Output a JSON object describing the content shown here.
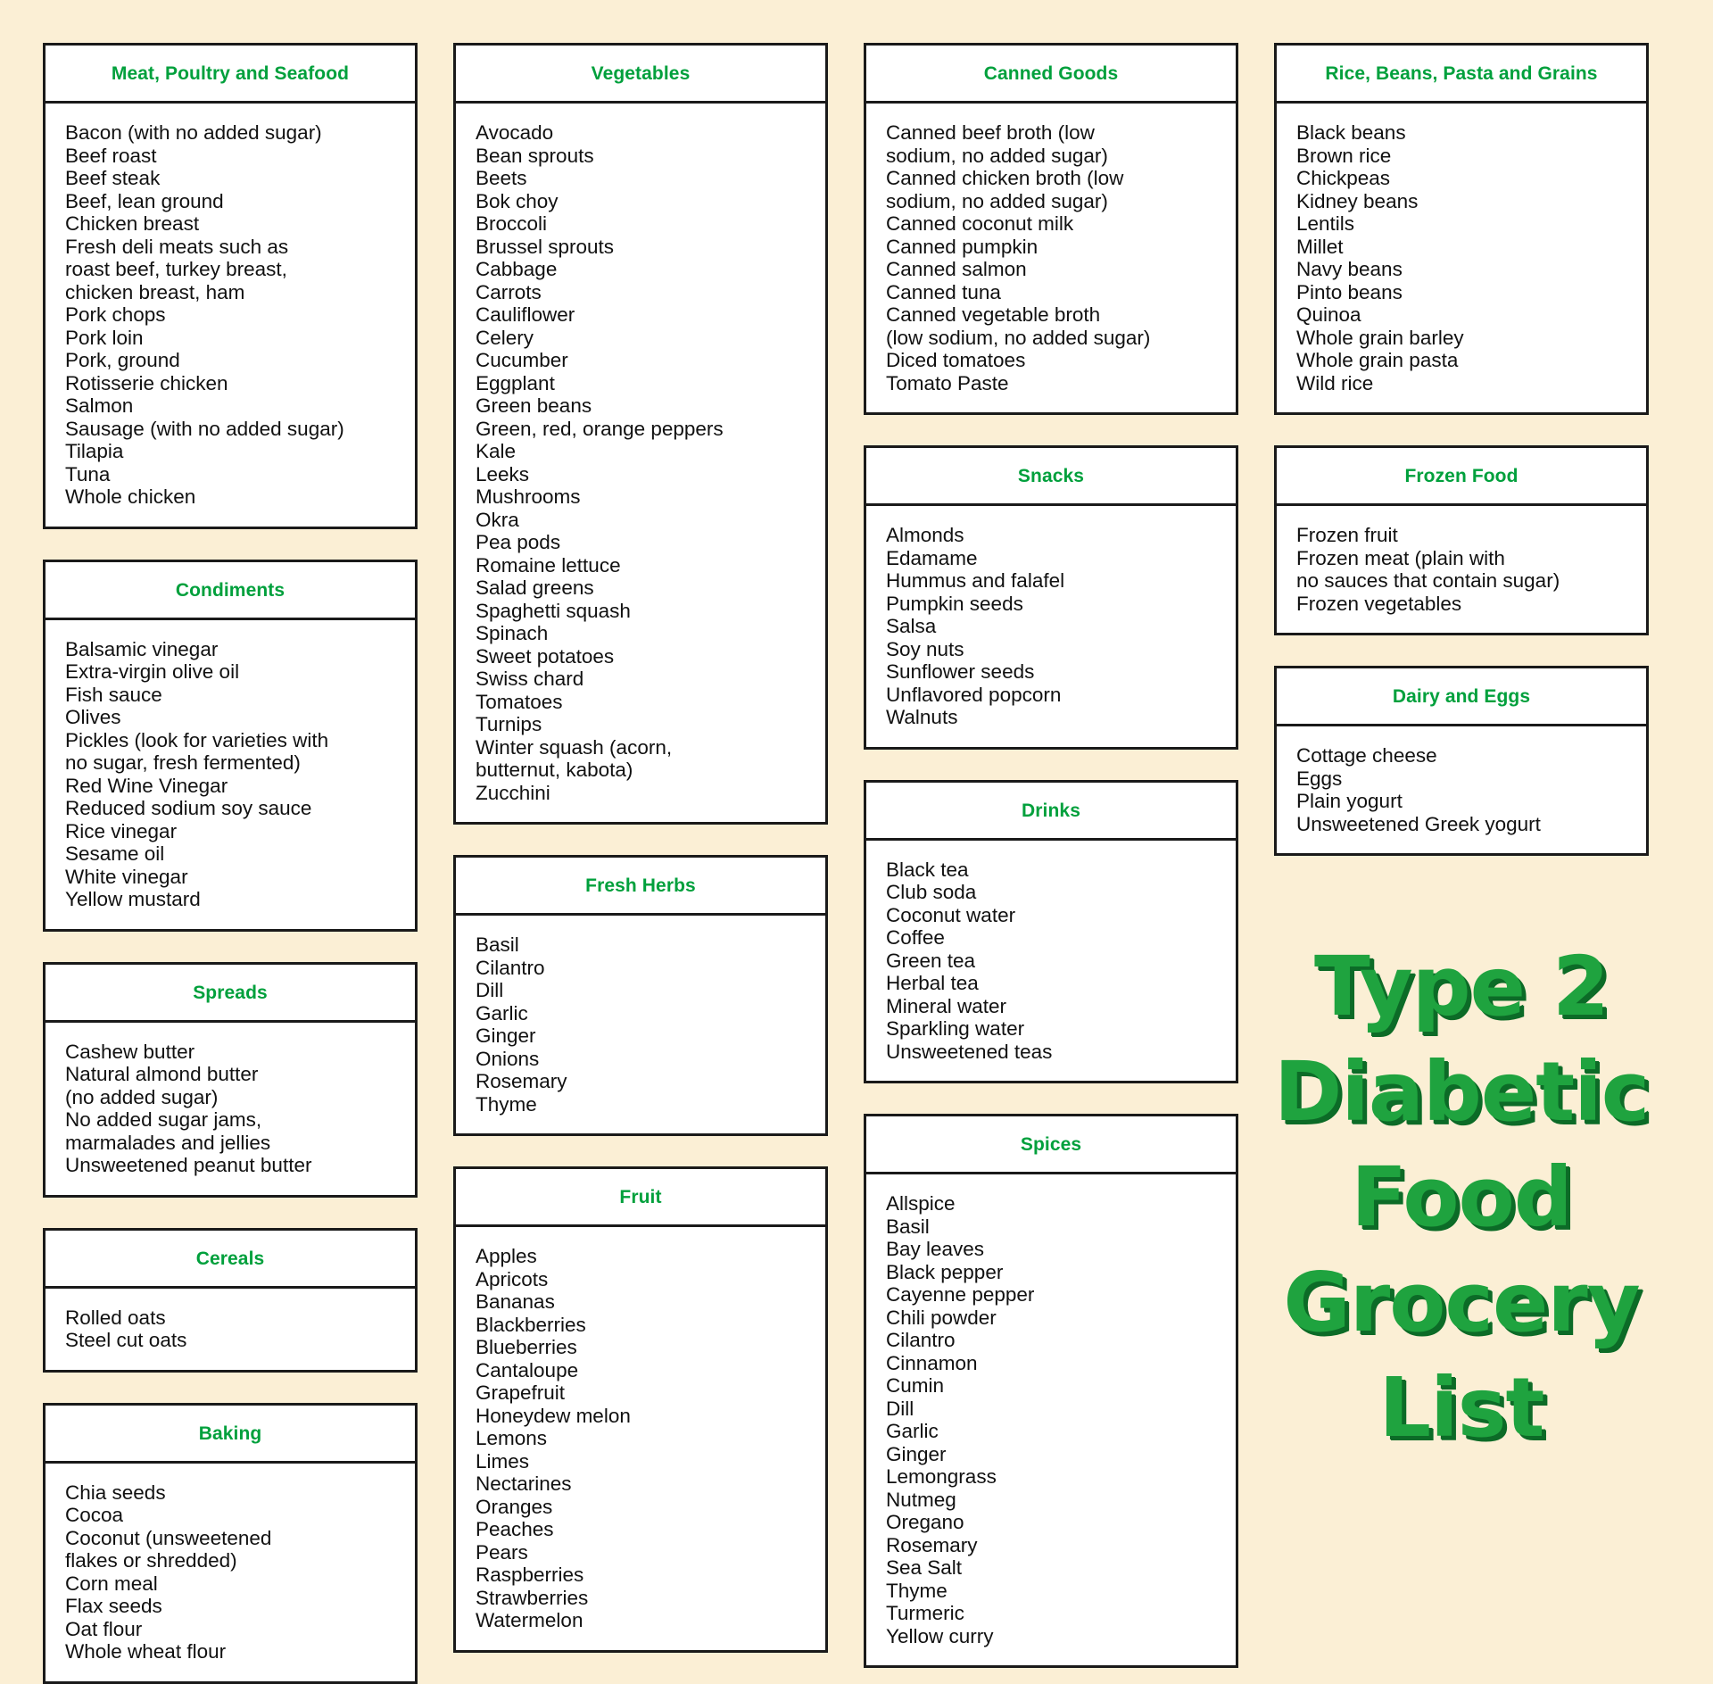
{
  "theme": {
    "background": "#fbefd5",
    "header_green": "#00a03c",
    "title_green": "#1fa33f",
    "title_shadow_green": "#0c6b27",
    "border": "#1a1a1a",
    "card_background": "#ffffff",
    "text": "#111111"
  },
  "title": {
    "lines": [
      "Type 2",
      "Diabetic",
      "Food",
      "Grocery",
      "List"
    ]
  },
  "columns": [
    {
      "name": "column-1",
      "sections": [
        {
          "heading": "Meat, Poultry and Seafood",
          "items": [
            "Bacon (with no added sugar)",
            "Beef roast",
            "Beef steak",
            "Beef, lean ground",
            "Chicken breast",
            "Fresh deli meats such as\nroast beef, turkey breast,\nchicken breast, ham",
            "Pork chops",
            "Pork loin",
            "Pork, ground",
            "Rotisserie chicken",
            "Salmon",
            "Sausage (with no added sugar)",
            "Tilapia",
            "Tuna",
            "Whole chicken"
          ]
        },
        {
          "heading": "Condiments",
          "items": [
            "Balsamic vinegar",
            "Extra-virgin olive oil",
            "Fish sauce",
            "Olives",
            "Pickles (look for varieties with\nno sugar, fresh fermented)",
            "Red Wine Vinegar",
            "Reduced sodium soy sauce",
            "Rice vinegar",
            "Sesame oil",
            "White vinegar",
            "Yellow mustard"
          ]
        },
        {
          "heading": "Spreads",
          "items": [
            "Cashew butter",
            "Natural almond butter\n(no added sugar)",
            "No added sugar jams,\nmarmalades and jellies",
            "Unsweetened peanut butter"
          ]
        },
        {
          "heading": "Cereals",
          "items": [
            "Rolled oats",
            "Steel cut oats"
          ]
        },
        {
          "heading": "Baking",
          "items": [
            "Chia seeds",
            "Cocoa",
            "Coconut (unsweetened\nflakes or shredded)",
            "Corn meal",
            "Flax seeds",
            "Oat flour",
            "Whole wheat flour"
          ]
        }
      ]
    },
    {
      "name": "column-2",
      "sections": [
        {
          "heading": "Vegetables",
          "items": [
            "Avocado",
            "Bean sprouts",
            "Beets",
            "Bok choy",
            "Broccoli",
            "Brussel sprouts",
            "Cabbage",
            "Carrots",
            "Cauliflower",
            "Celery",
            "Cucumber",
            "Eggplant",
            "Green beans",
            "Green, red, orange peppers",
            "Kale",
            "Leeks",
            "Mushrooms",
            "Okra",
            "Pea pods",
            "Romaine lettuce",
            "Salad greens",
            "Spaghetti squash",
            "Spinach",
            "Sweet potatoes",
            "Swiss chard",
            "Tomatoes",
            "Turnips",
            "Winter squash (acorn,\nbutternut, kabota)",
            "Zucchini"
          ]
        },
        {
          "heading": "Fresh Herbs",
          "items": [
            "Basil",
            "Cilantro",
            "Dill",
            "Garlic",
            "Ginger",
            "Onions",
            "Rosemary",
            "Thyme"
          ]
        },
        {
          "heading": "Fruit",
          "items": [
            "Apples",
            "Apricots",
            "Bananas",
            "Blackberries",
            "Blueberries",
            "Cantaloupe",
            "Grapefruit",
            "Honeydew melon",
            "Lemons",
            "Limes",
            "Nectarines",
            "Oranges",
            "Peaches",
            "Pears",
            "Raspberries",
            "Strawberries",
            "Watermelon"
          ]
        }
      ]
    },
    {
      "name": "column-3",
      "sections": [
        {
          "heading": "Canned Goods",
          "items": [
            "Canned beef broth (low\nsodium, no added sugar)",
            "Canned chicken broth (low\nsodium, no added sugar)",
            "Canned coconut milk",
            "Canned pumpkin",
            "Canned salmon",
            "Canned tuna",
            "Canned vegetable broth\n(low sodium, no added sugar)",
            "Diced tomatoes",
            "Tomato Paste"
          ]
        },
        {
          "heading": "Snacks",
          "items": [
            "Almonds",
            "Edamame",
            "Hummus and falafel",
            "Pumpkin seeds",
            "Salsa",
            "Soy nuts",
            "Sunflower seeds",
            "Unflavored popcorn",
            "Walnuts"
          ]
        },
        {
          "heading": "Drinks",
          "items": [
            "Black tea",
            "Club soda",
            "Coconut water",
            "Coffee",
            "Green tea",
            "Herbal tea",
            "Mineral water",
            "Sparkling water",
            "Unsweetened teas"
          ]
        },
        {
          "heading": "Spices",
          "items": [
            "Allspice",
            "Basil",
            "Bay leaves",
            "Black pepper",
            "Cayenne pepper",
            "Chili powder",
            "Cilantro",
            "Cinnamon",
            "Cumin",
            "Dill",
            "Garlic",
            "Ginger",
            "Lemongrass",
            "Nutmeg",
            "Oregano",
            "Rosemary",
            "Sea Salt",
            "Thyme",
            "Turmeric",
            "Yellow curry"
          ]
        }
      ]
    },
    {
      "name": "column-4",
      "sections": [
        {
          "heading": "Rice, Beans, Pasta and Grains",
          "items": [
            "Black beans",
            "Brown rice",
            "Chickpeas",
            "Kidney beans",
            "Lentils",
            "Millet",
            "Navy beans",
            "Pinto beans",
            "Quinoa",
            "Whole grain barley",
            "Whole grain pasta",
            "Wild rice"
          ]
        },
        {
          "heading": "Frozen Food",
          "items": [
            "Frozen fruit",
            "Frozen meat (plain with\nno sauces that contain sugar)",
            "Frozen vegetables"
          ]
        },
        {
          "heading": "Dairy and Eggs",
          "items": [
            "Cottage cheese",
            "Eggs",
            "Plain yogurt",
            "Unsweetened Greek yogurt"
          ]
        }
      ]
    }
  ]
}
